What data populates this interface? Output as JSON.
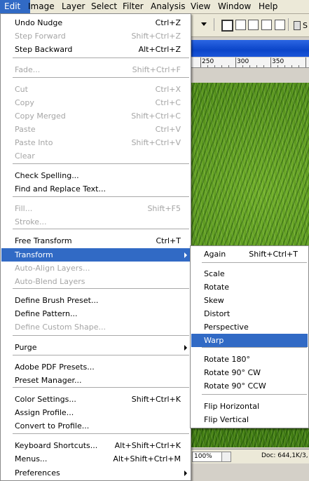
{
  "menubar": {
    "items": [
      "Edit",
      "Image",
      "Layer",
      "Select",
      "Filter",
      "Analysis",
      "View",
      "Window",
      "Help"
    ]
  },
  "ruler": {
    "ticks": [
      "250",
      "300",
      "350"
    ]
  },
  "status": {
    "zoom": "100%",
    "doc_info": "Doc: 644,1K/3,"
  },
  "edit_menu": {
    "items": [
      {
        "label": "Undo Nudge",
        "shortcut": "Ctrl+Z",
        "enabled": true
      },
      {
        "label": "Step Forward",
        "shortcut": "Shift+Ctrl+Z",
        "enabled": false
      },
      {
        "label": "Step Backward",
        "shortcut": "Alt+Ctrl+Z",
        "enabled": true
      },
      {
        "label": "Fade...",
        "shortcut": "Shift+Ctrl+F",
        "enabled": false
      },
      {
        "label": "Cut",
        "shortcut": "Ctrl+X",
        "enabled": false
      },
      {
        "label": "Copy",
        "shortcut": "Ctrl+C",
        "enabled": false
      },
      {
        "label": "Copy Merged",
        "shortcut": "Shift+Ctrl+C",
        "enabled": false
      },
      {
        "label": "Paste",
        "shortcut": "Ctrl+V",
        "enabled": false
      },
      {
        "label": "Paste Into",
        "shortcut": "Shift+Ctrl+V",
        "enabled": false
      },
      {
        "label": "Clear",
        "shortcut": "",
        "enabled": false
      },
      {
        "label": "Check Spelling...",
        "shortcut": "",
        "enabled": true
      },
      {
        "label": "Find and Replace Text...",
        "shortcut": "",
        "enabled": true
      },
      {
        "label": "Fill...",
        "shortcut": "Shift+F5",
        "enabled": false
      },
      {
        "label": "Stroke...",
        "shortcut": "",
        "enabled": false
      },
      {
        "label": "Free Transform",
        "shortcut": "Ctrl+T",
        "enabled": true
      },
      {
        "label": "Transform",
        "shortcut": "",
        "enabled": true
      },
      {
        "label": "Auto-Align Layers...",
        "shortcut": "",
        "enabled": false
      },
      {
        "label": "Auto-Blend Layers",
        "shortcut": "",
        "enabled": false
      },
      {
        "label": "Define Brush Preset...",
        "shortcut": "",
        "enabled": true
      },
      {
        "label": "Define Pattern...",
        "shortcut": "",
        "enabled": true
      },
      {
        "label": "Define Custom Shape...",
        "shortcut": "",
        "enabled": false
      },
      {
        "label": "Purge",
        "shortcut": "",
        "enabled": true
      },
      {
        "label": "Adobe PDF Presets...",
        "shortcut": "",
        "enabled": true
      },
      {
        "label": "Preset Manager...",
        "shortcut": "",
        "enabled": true
      },
      {
        "label": "Color Settings...",
        "shortcut": "Shift+Ctrl+K",
        "enabled": true
      },
      {
        "label": "Assign Profile...",
        "shortcut": "",
        "enabled": true
      },
      {
        "label": "Convert to Profile...",
        "shortcut": "",
        "enabled": true
      },
      {
        "label": "Keyboard Shortcuts...",
        "shortcut": "Alt+Shift+Ctrl+K",
        "enabled": true
      },
      {
        "label": "Menus...",
        "shortcut": "Alt+Shift+Ctrl+M",
        "enabled": true
      },
      {
        "label": "Preferences",
        "shortcut": "",
        "enabled": true
      }
    ]
  },
  "transform_menu": {
    "items": [
      {
        "label": "Again",
        "shortcut": "Shift+Ctrl+T"
      },
      {
        "label": "Scale",
        "shortcut": ""
      },
      {
        "label": "Rotate",
        "shortcut": ""
      },
      {
        "label": "Skew",
        "shortcut": ""
      },
      {
        "label": "Distort",
        "shortcut": ""
      },
      {
        "label": "Perspective",
        "shortcut": ""
      },
      {
        "label": "Warp",
        "shortcut": ""
      },
      {
        "label": "Rotate 180°",
        "shortcut": ""
      },
      {
        "label": "Rotate 90° CW",
        "shortcut": ""
      },
      {
        "label": "Rotate 90° CCW",
        "shortcut": ""
      },
      {
        "label": "Flip Horizontal",
        "shortcut": ""
      },
      {
        "label": "Flip Vertical",
        "shortcut": ""
      }
    ]
  },
  "colors": {
    "highlight": "#316ac5",
    "disabled_text": "#a5a5a5"
  }
}
